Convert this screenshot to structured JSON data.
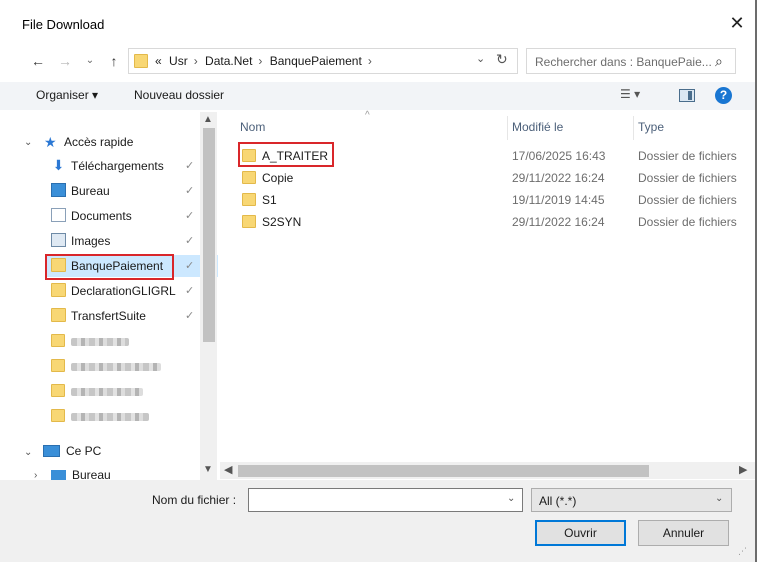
{
  "window": {
    "title": "File Download",
    "close_glyph": "✕"
  },
  "address": {
    "prefix": "«",
    "crumbs": [
      "Usr",
      "Data.Net",
      "BanquePaiement"
    ],
    "separator": "›"
  },
  "search": {
    "placeholder": "Rechercher dans : BanquePaie..."
  },
  "toolbar": {
    "organise_label": "Organiser ▾",
    "new_folder_label": "Nouveau dossier"
  },
  "sidebar": {
    "quick_access_label": "Accès rapide",
    "items": [
      {
        "label": "Téléchargements",
        "icon": "download-arrow-icon",
        "pinned": true
      },
      {
        "label": "Bureau",
        "icon": "desktop-icon",
        "pinned": true
      },
      {
        "label": "Documents",
        "icon": "documents-icon",
        "pinned": true
      },
      {
        "label": "Images",
        "icon": "images-icon",
        "pinned": true
      },
      {
        "label": "BanquePaiement",
        "icon": "folder-icon",
        "pinned": true,
        "selected": true
      },
      {
        "label": "DeclarationGLIGRL",
        "icon": "folder-icon",
        "pinned": true
      },
      {
        "label": "TransfertSuite",
        "icon": "folder-icon",
        "pinned": true
      }
    ],
    "pc_label": "Ce PC",
    "pc_child_label": "Bureau"
  },
  "columns": {
    "name": "Nom",
    "modified": "Modifié le",
    "type": "Type"
  },
  "files": [
    {
      "name": "A_TRAITER",
      "modified": "17/06/2025 16:43",
      "type": "Dossier de fichiers"
    },
    {
      "name": "Copie",
      "modified": "29/11/2022 16:24",
      "type": "Dossier de fichiers"
    },
    {
      "name": "S1",
      "modified": "19/11/2019 14:45",
      "type": "Dossier de fichiers"
    },
    {
      "name": "S2SYN",
      "modified": "29/11/2022 16:24",
      "type": "Dossier de fichiers"
    }
  ],
  "bottom": {
    "filename_label": "Nom du fichier :",
    "filename_value": "",
    "filter_value": "All (*.*)",
    "open_label": "Ouvrir",
    "cancel_label": "Annuler"
  },
  "colors": {
    "accent": "#0078d7",
    "selection": "#cce8ff",
    "folder": "#f8d774",
    "highlight_box": "#d9262a",
    "help": "#1976d2"
  }
}
